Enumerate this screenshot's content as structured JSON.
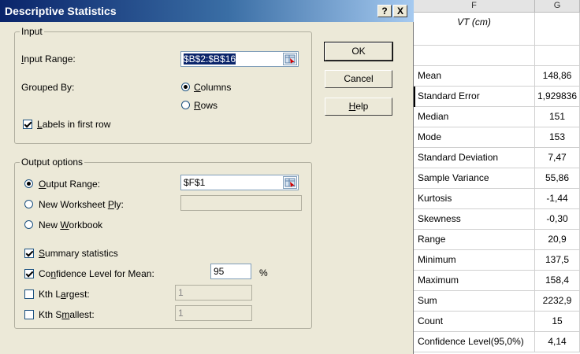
{
  "dialog": {
    "title": "Descriptive Statistics",
    "help_btn": "?",
    "close_btn": "X",
    "input_group": {
      "legend": "Input",
      "input_range_label_u": "I",
      "input_range_label_rest": "nput Range:",
      "input_range_value": "$B$2:$B$16",
      "grouped_by_label": "Grouped By:",
      "columns_u": "C",
      "columns_rest": "olumns",
      "rows_u": "R",
      "rows_rest": "ows",
      "grouped_by_selected": "Columns",
      "labels_u": "L",
      "labels_rest": "abels in first row",
      "labels_checked": true
    },
    "output_group": {
      "legend": "Output options",
      "output_range_u": "O",
      "output_range_rest": "utput Range:",
      "output_range_value": "$F$1",
      "new_ply_pre": "New Worksheet ",
      "new_ply_u": "P",
      "new_ply_post": "ly:",
      "new_ply_value": "",
      "new_wb_pre": "New ",
      "new_wb_u": "W",
      "new_wb_post": "orkbook",
      "selected_option": "Output Range",
      "summary_u": "S",
      "summary_rest": "ummary statistics",
      "summary_checked": true,
      "conf_pre": "Co",
      "conf_u": "n",
      "conf_post": "fidence Level for Mean:",
      "conf_checked": true,
      "conf_value": "95",
      "conf_unit": "%",
      "kth_largest_pre": "Kth L",
      "kth_largest_u": "a",
      "kth_largest_post": "rgest:",
      "kth_largest_value": "1",
      "kth_largest_checked": false,
      "kth_smallest_pre": "Kth S",
      "kth_smallest_u": "m",
      "kth_smallest_post": "allest:",
      "kth_smallest_value": "1",
      "kth_smallest_checked": false
    },
    "buttons": {
      "ok": "OK",
      "cancel": "Cancel",
      "help_u": "H",
      "help_rest": "elp"
    }
  },
  "sheet": {
    "columns": [
      "F",
      "G"
    ],
    "header_label": "VT (cm)",
    "rows": [
      {
        "label": "Mean",
        "value": "148,86"
      },
      {
        "label": "Standard Error",
        "value": "1,929836"
      },
      {
        "label": "Median",
        "value": "151"
      },
      {
        "label": "Mode",
        "value": "153"
      },
      {
        "label": "Standard Deviation",
        "value": "7,47"
      },
      {
        "label": "Sample Variance",
        "value": "55,86"
      },
      {
        "label": "Kurtosis",
        "value": "-1,44"
      },
      {
        "label": "Skewness",
        "value": "-0,30"
      },
      {
        "label": "Range",
        "value": "20,9"
      },
      {
        "label": "Minimum",
        "value": "137,5"
      },
      {
        "label": "Maximum",
        "value": "158,4"
      },
      {
        "label": "Sum",
        "value": "2232,9"
      },
      {
        "label": "Count",
        "value": "15"
      },
      {
        "label": "Confidence Level(95,0%)",
        "value": "4,14"
      }
    ]
  }
}
